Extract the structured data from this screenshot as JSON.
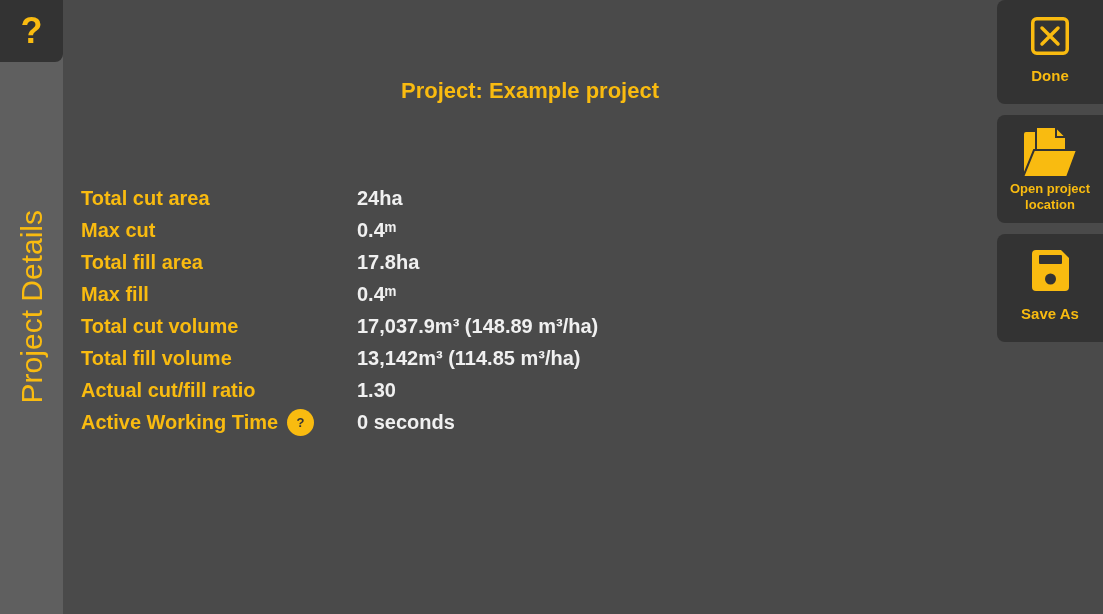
{
  "help_button": {
    "label": "?"
  },
  "sidebar": {
    "title": "Project Details"
  },
  "project_title": "Project: Example project",
  "details": [
    {
      "label": "Total cut area",
      "value": "24ha"
    },
    {
      "label": "Max cut",
      "value": "0.4ᵐ"
    },
    {
      "label": "Total fill area",
      "value": "17.8ha"
    },
    {
      "label": "Max fill",
      "value": "0.4ᵐ"
    },
    {
      "label": "Total cut volume",
      "value": "17,037.9m³ (148.89 m³/ha)"
    },
    {
      "label": "Total fill volume",
      "value": "13,142m³ (114.85 m³/ha)"
    },
    {
      "label": "Actual cut/fill ratio",
      "value": "1.30"
    },
    {
      "label": "Active Working Time",
      "info_button": "?",
      "value": "0 seconds"
    }
  ],
  "actions": [
    {
      "kind": "close",
      "label": "Done"
    },
    {
      "kind": "folder",
      "label": "Open project location"
    },
    {
      "kind": "save",
      "label": "Save As"
    }
  ]
}
